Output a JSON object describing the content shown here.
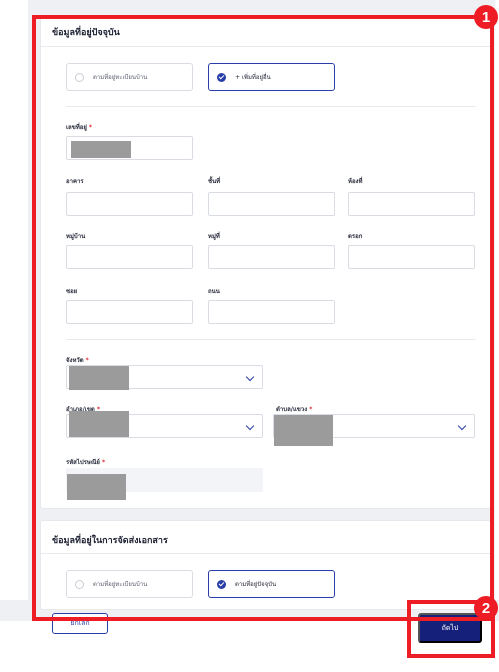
{
  "current_address": {
    "title": "ข้อมูลที่อยู่ปัจจุบัน",
    "options": [
      {
        "label": "ตามที่อยู่ทะเบียนบ้าน",
        "selected": false
      },
      {
        "label": "+ เพิ่มที่อยู่อื่น",
        "selected": true
      }
    ],
    "fields": {
      "house_no": {
        "label": "เลขที่อยู่",
        "required": "*"
      },
      "building": {
        "label": "อาคาร"
      },
      "floor": {
        "label": "ชั้นที่"
      },
      "room": {
        "label": "ห้องที่"
      },
      "village": {
        "label": "หมู่บ้าน"
      },
      "moo": {
        "label": "หมู่ที่"
      },
      "alley": {
        "label": "ตรอก"
      },
      "soi": {
        "label": "ซอย"
      },
      "road": {
        "label": "ถนน"
      },
      "province": {
        "label": "จังหวัด",
        "required": "*"
      },
      "district": {
        "label": "อำเภอ/เขต",
        "required": "*"
      },
      "subdistrict": {
        "label": "ตำบล/แขวง",
        "required": "*"
      },
      "postcode": {
        "label": "รหัสไปรษณีย์",
        "required": "*"
      }
    }
  },
  "delivery_address": {
    "title": "ข้อมูลที่อยู่ในการจัดส่งเอกสาร",
    "options": [
      {
        "label": "ตามที่อยู่ทะเบียนบ้าน",
        "selected": false
      },
      {
        "label": "ตามที่อยู่ปัจจุบัน",
        "selected": true
      }
    ]
  },
  "footer": {
    "cancel_label": "ยกเลิก",
    "next_label": "ถัดไป"
  },
  "annotations": {
    "marker_1": "1",
    "marker_2": "2"
  },
  "colors": {
    "primary": "#14207a",
    "accent": "#2a3ea8",
    "annotation_red": "#ee1c24",
    "required": "#e0262d",
    "redaction": "#9b9b9b"
  }
}
